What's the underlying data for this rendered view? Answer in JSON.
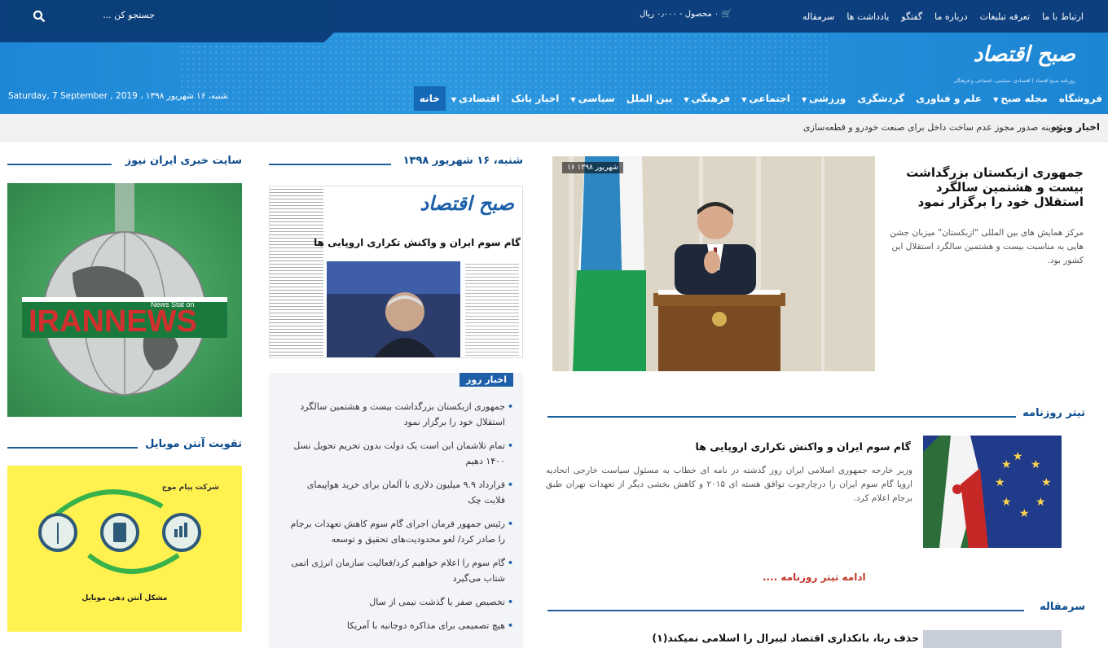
{
  "topbar": {
    "links": [
      "سرمقاله",
      "یادداشت ها",
      "گفتگو",
      "درباره ما",
      "تعرفه تبلیغات",
      "ارتباط با ما"
    ],
    "cart": "۰ محصول - ۰٫۰۰۰ ریال",
    "search_placeholder": "جستجو کن ..."
  },
  "brand": {
    "logo": "صبح اقتصاد",
    "tagline": "روزنامه صبح اقتصاد | اقتصادی، سیاسی، اجتماعی و فرهنگی"
  },
  "date_line": "شنبه، ۱۶ شهریور ۱۳۹۸ ، Saturday, 7 September , 2019",
  "nav": {
    "items": [
      {
        "label": "خانه",
        "dropdown": false,
        "active": true
      },
      {
        "label": "اقتصادی",
        "dropdown": true,
        "active": false
      },
      {
        "label": "اخبار بانک",
        "dropdown": false,
        "active": false
      },
      {
        "label": "سیاسی",
        "dropdown": true,
        "active": false
      },
      {
        "label": "بین الملل",
        "dropdown": false,
        "active": false
      },
      {
        "label": "فرهنگی",
        "dropdown": true,
        "active": false
      },
      {
        "label": "اجتماعی",
        "dropdown": true,
        "active": false
      },
      {
        "label": "ورزشی",
        "dropdown": true,
        "active": false
      },
      {
        "label": "گردشگری",
        "dropdown": false,
        "active": false
      },
      {
        "label": "علم و فناوری",
        "dropdown": false,
        "active": false
      },
      {
        "label": "مجله صبح",
        "dropdown": true,
        "active": false
      },
      {
        "label": "فروشگاه",
        "dropdown": false,
        "active": false
      }
    ]
  },
  "ticker": {
    "label": "اخبار ویژه",
    "text": "هزینه صدور مجوز عدم ساخت داخل برای صنعت خودرو و قطعه‌سازی"
  },
  "main_story": {
    "photo_date": "۱۶ شهریور ۱۳۹۸",
    "title": "جمهوری ازبکستان بزرگداشت بیست و هشتمین سالگرد استقلال خود را برگزار نمود",
    "summary": "مرکز همایش های بین المللی \"ازبکستان\" میزبان جشن هایی به مناسبت بیست و هشتمین سالگرد استقلال این کشور بود."
  },
  "newspaper_title_section": {
    "heading": "تیتر روزنامه",
    "article_title": "گام سوم ایران و واکنش تکراری اروپایی ها",
    "article_summary": "وزیر خارجه جمهوری اسلامی ایران روز گذشته در نامه ای خطاب به مسئول سیاست خارجی اتحادیه اروپا گام سوم ایران را درچارچوب توافق هسته ای ۲۰۱۵ و کاهش بخشی دیگر از تعهدات تهران طبق برجام اعلام کرد.",
    "more_link": "ادامه تیتر روزنامه ...."
  },
  "editorial": {
    "heading": "سرمقاله",
    "title": "حذف ربا، بانکداری اقتصاد لیبرال را اسلامی نمیکند(۱)"
  },
  "middle": {
    "date_heading": "شنبه، ۱۶ شهریور ۱۳۹۸",
    "newspaper_logo": "صبح اقتصاد",
    "newspaper_headline": "گام سوم ایران و واکنش تکراری اروپایی ها",
    "news_label": "اخبار روز",
    "news": [
      "جمهوری ازبکستان بزرگداشت بیست و هشتمین سالگرد استقلال خود را برگزار نمود",
      "تمام تلاشمان این است یک دولت بدون تحریم تحویل نسل ۱۴۰۰ دهیم",
      "قرارداد ۹.۹ میلیون دلاری با آلمان برای خرید هواپیمای فلایت چک",
      "رئیس جمهور فرمان اجرای گام سوم کاهش تعهدات برجام را صادر کرد/ لغو محدودیت‌های تحقیق و توسعه",
      "گام سوم را اعلام خواهیم کرد/فعالیت سازمان انرژی اتمی شتاب می‌گیرد",
      "تخصیص صفر یا گذشت نیمی از سال",
      "هیچ تصمیمی برای مذاکره دوجانبه با آمریکا"
    ]
  },
  "sidebar": {
    "iran_heading": "سایت خبری ایران نیوز",
    "iran_banner_text": "IRANNEWS",
    "iran_banner_small": "News Stat on",
    "mobile_heading": "تقویت آنتن موبایل",
    "mobile_company": "شرکت پیام موج",
    "mobile_caption": "مشکل آنتن دهی موبایل"
  },
  "colors": {
    "topbar": "#0d3f7e",
    "banner": "#2b97e0",
    "accent": "#1d5fa8",
    "more_link": "#c0392b"
  }
}
